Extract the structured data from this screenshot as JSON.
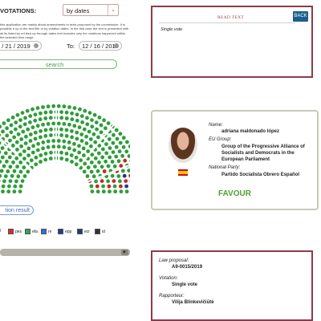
{
  "search": {
    "label": "VOTATIONS:",
    "mode_value": "by dates",
    "note": "this application are mainly about amendments to texts proposed by the commission. It is possible d up in the text title or by votation dates. In the first case the text is presented with all its listed by ref iked up through dates text includes only the votations happened within the selected time range.",
    "from_date": "0 / 21 / 2019",
    "to_label": "To:",
    "to_date": "12 / 16 / 2019",
    "search_button": "search",
    "vote_result_button": "tion result"
  },
  "legend": [
    {
      "code": "d",
      "color": "#8b1a1a"
    },
    {
      "code": "pes",
      "color": "#d62b2b"
    },
    {
      "code": "efa",
      "color": "#2fa84a"
    },
    {
      "code": "re",
      "color": "#2b6fd6"
    },
    {
      "code": "epp",
      "color": "#1f3f8f"
    },
    {
      "code": "ecr",
      "color": "#1b3c73"
    },
    {
      "code": "id",
      "color": "#333333"
    }
  ],
  "read_panel": {
    "header": "READ TEXT",
    "back_button": "BACK",
    "content": "Single vote"
  },
  "mep": {
    "name_label": "Name:",
    "name": "adriana maldonado lópez",
    "group_label": "EU Group:",
    "group": "Group of the Progressive Alliance of Socialists and Democrats in the European Parliament",
    "party_label": "National Party:",
    "party": "Partido Socialista Obrero Español",
    "vote": "FAVOUR"
  },
  "law": {
    "proposal_label": "Law proposal:",
    "proposal": "A9-0015/2019",
    "votation_label": "Votation:",
    "votation": "Single vote",
    "rapporteur_label": "Rapporteur:",
    "rapporteur": "Vilija Blinkevičiūtė"
  },
  "colors": {
    "panel_border": "#8c3b4a",
    "favour": "#4ea031",
    "seat_green": "#2e9e3a",
    "seat_red": "#c62828",
    "back_button": "#1b5f8c"
  }
}
